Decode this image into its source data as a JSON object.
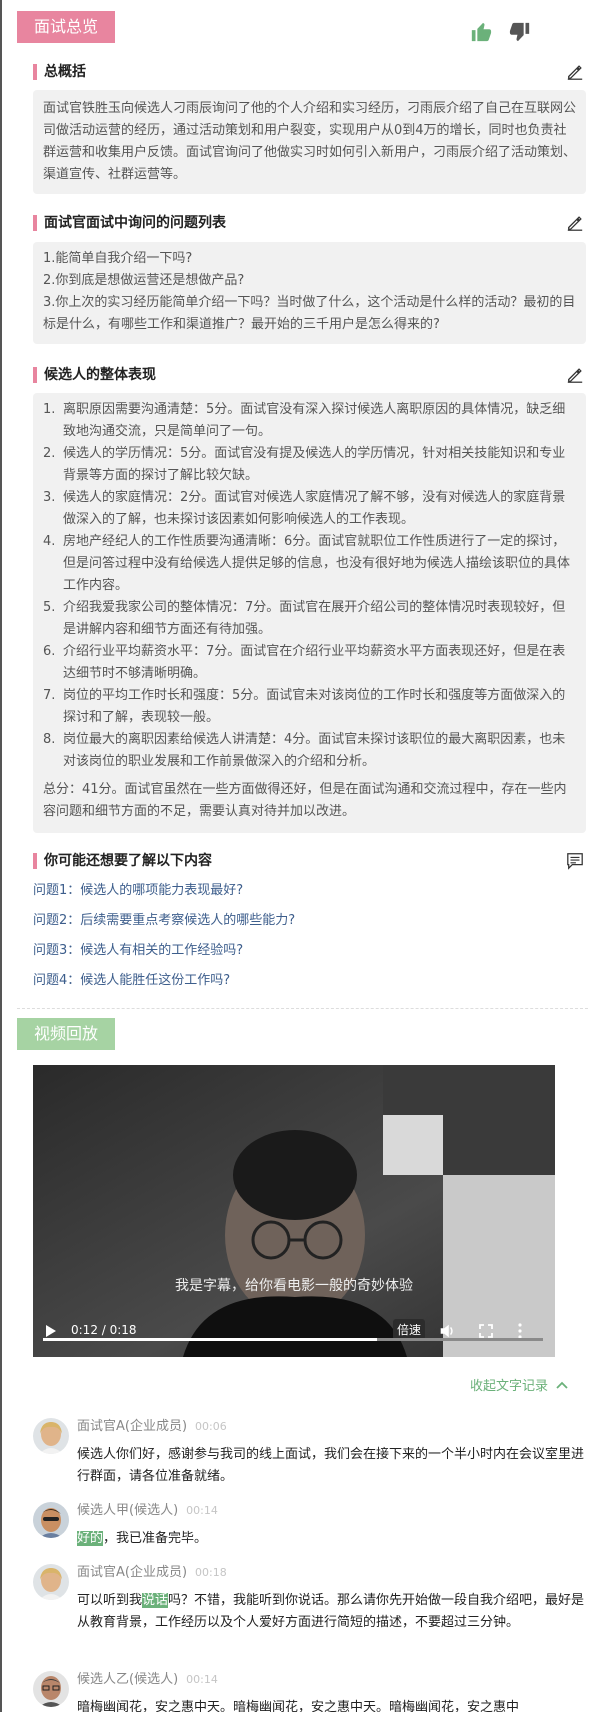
{
  "overview": {
    "tag": "面试总览",
    "summary": {
      "title": "总概括",
      "text": "面试官铁胜玉向候选人刁雨辰询问了他的个人介绍和实习经历，刁雨辰介绍了自己在互联网公司做活动运营的经历，通过活动策划和用户裂变，实现用户从0到4万的增长，同时也负责社群运营和收集用户反馈。面试官询问了他做实习时如何引入新用户，刁雨辰介绍了活动策划、渠道宣传、社群运营等。"
    },
    "questions": {
      "title": "面试官面试中询问的问题列表",
      "items": [
        "1.能简单自我介绍一下吗?",
        "2.你到底是想做运营还是想做产品?",
        "3.你上次的实习经历能简单介绍一下吗？当时做了什么，这个活动是什么样的活动？最初的目标是什么，有哪些工作和渠道推广？最开始的三千用户是怎么得来的?"
      ]
    },
    "performance": {
      "title": "候选人的整体表现",
      "items": [
        {
          "num": "1.",
          "text": "离职原因需要沟通清楚：5分。面试官没有深入探讨候选人离职原因的具体情况，缺乏细致地沟通交流，只是简单问了一句。"
        },
        {
          "num": "2.",
          "text": "候选人的学历情况：5分。面试官没有提及候选人的学历情况，针对相关技能知识和专业背景等方面的探讨了解比较欠缺。"
        },
        {
          "num": "3.",
          "text": "候选人的家庭情况：2分。面试官对候选人家庭情况了解不够，没有对候选人的家庭背景做深入的了解，也未探讨该因素如何影响候选人的工作表现。"
        },
        {
          "num": "4.",
          "text": "房地产经纪人的工作性质要沟通清晰：6分。面试官就职位工作性质进行了一定的探讨，但是问答过程中没有给候选人提供足够的信息，也没有很好地为候选人描绘该职位的具体工作内容。"
        },
        {
          "num": "5.",
          "text": "介绍我爱我家公司的整体情况：7分。面试官在展开介绍公司的整体情况时表现较好，但是讲解内容和细节方面还有待加强。"
        },
        {
          "num": "6.",
          "text": "介绍行业平均薪资水平：7分。面试官在介绍行业平均薪资水平方面表现还好，但是在表达细节时不够清晰明确。"
        },
        {
          "num": "7.",
          "text": "岗位的平均工作时长和强度：5分。面试官未对该岗位的工作时长和强度等方面做深入的探讨和了解，表现较一般。"
        },
        {
          "num": "8.",
          "text": "岗位最大的离职因素给候选人讲清楚：4分。面试官未探讨该职位的最大离职因素，也未对该岗位的职业发展和工作前景做深入的介绍和分析。"
        }
      ],
      "total": "总分：41分。面试官虽然在一些方面做得还好，但是在面试沟通和交流过程中，存在一些内容问题和细节方面的不足，需要认真对待并加以改进。"
    },
    "more": {
      "title": "你可能还想要了解以下内容",
      "items": [
        "问题1：候选人的哪项能力表现最好?",
        "问题2：后续需要重点考察候选人的哪些能力?",
        "问题3：候选人有相关的工作经验吗?",
        "问题4：候选人能胜任这份工作吗?"
      ]
    }
  },
  "video": {
    "tag": "视频回放",
    "subtitle": "我是字幕，给你看电影一般的奇妙体验",
    "time": "0:12 / 0:18",
    "speed_label": "倍速",
    "progress": 0.667,
    "collapse_label": "收起文字记录"
  },
  "transcript": [
    {
      "speaker": "面试官A(企业成员)",
      "time": "00:06",
      "pre": "候选人你们好，感谢参与我司的线上面试，我们会在接下来的一个半小时内在会议室里进行群面，请各位准备就绪。",
      "hl": "",
      "post": ""
    },
    {
      "speaker": "候选人甲(候选人)",
      "time": "00:14",
      "pre": "",
      "hl": "好的",
      "post": "，我已准备完毕。"
    },
    {
      "speaker": "面试官A(企业成员)",
      "time": "00:18",
      "pre": "可以听到我",
      "hl": "说话",
      "post": "吗？不错，我能听到你说话。那么请你先开始做一段自我介绍吧，最好是从教育背景，工作经历以及个人爱好方面进行简短的描述，不要超过三分钟。"
    },
    {
      "speaker": "候选人乙(候选人)",
      "time": "00:14",
      "pre": "暗梅幽闻花，安之惠中天。暗梅幽闻花，安之惠中天。暗梅幽闻花，安之惠中",
      "hl": "",
      "post": ""
    }
  ],
  "colors": {
    "accent_pink": "#e8859f",
    "accent_green": "#6bb17a",
    "link_blue": "#3d5e8c"
  }
}
